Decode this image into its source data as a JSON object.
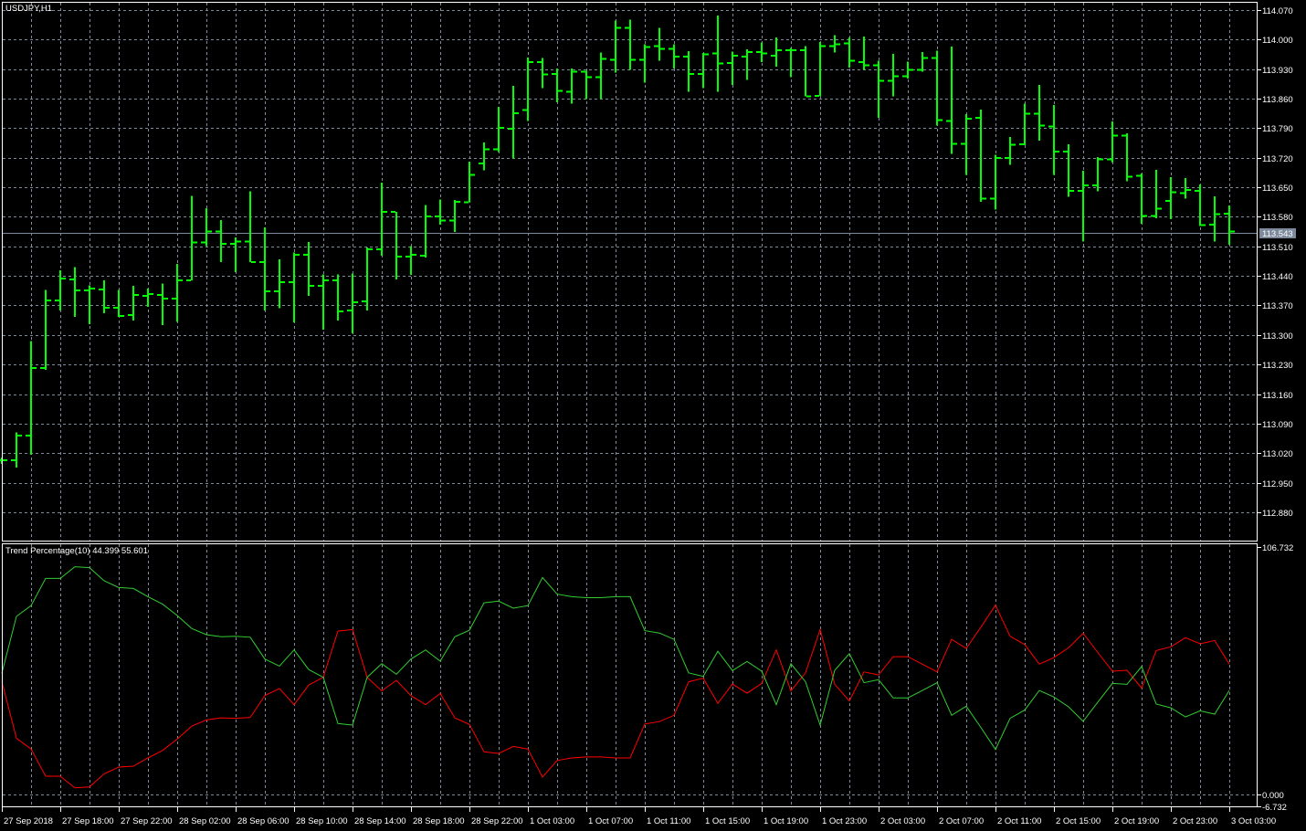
{
  "chart": {
    "symbol_title": "USDJPY,H1",
    "current_price": "113.543",
    "colors": {
      "background": "#000000",
      "bars": "#00ff00",
      "grid": "#7c8a9c",
      "frame": "#ffffff",
      "price_line": "#7c8a9c",
      "indicator_up": "#32cd32",
      "indicator_down": "#ff0000"
    },
    "price_axis_labels": [
      "114.070",
      "114.000",
      "113.930",
      "113.860",
      "113.790",
      "113.720",
      "113.650",
      "113.580",
      "113.510",
      "113.440",
      "113.370",
      "113.300",
      "113.230",
      "113.160",
      "113.090",
      "113.020",
      "112.950",
      "112.880"
    ],
    "time_axis_labels": [
      "27 Sep 2018",
      "27 Sep 18:00",
      "27 Sep 22:00",
      "28 Sep 02:00",
      "28 Sep 06:00",
      "28 Sep 10:00",
      "28 Sep 14:00",
      "28 Sep 18:00",
      "28 Sep 22:00",
      "1 Oct 03:00",
      "1 Oct 07:00",
      "1 Oct 11:00",
      "1 Oct 15:00",
      "1 Oct 19:00",
      "1 Oct 23:00",
      "2 Oct 03:00",
      "2 Oct 07:00",
      "2 Oct 11:00",
      "2 Oct 15:00",
      "2 Oct 19:00",
      "2 Oct 23:00",
      "3 Oct 03:00"
    ],
    "ohlc": [
      [
        113.003,
        113.01,
        112.995,
        113.003
      ],
      [
        113.003,
        113.069,
        112.986,
        113.062
      ],
      [
        113.062,
        113.286,
        113.016,
        113.222
      ],
      [
        113.222,
        113.407,
        113.217,
        113.382
      ],
      [
        113.382,
        113.453,
        113.358,
        113.434
      ],
      [
        113.432,
        113.461,
        113.343,
        113.406
      ],
      [
        113.406,
        113.418,
        113.326,
        113.41
      ],
      [
        113.408,
        113.429,
        113.352,
        113.365
      ],
      [
        113.365,
        113.407,
        113.343,
        113.345
      ],
      [
        113.347,
        113.416,
        113.334,
        113.395
      ],
      [
        113.393,
        113.41,
        113.367,
        113.397
      ],
      [
        113.395,
        113.422,
        113.324,
        113.386
      ],
      [
        113.386,
        113.468,
        113.331,
        113.43
      ],
      [
        113.43,
        113.63,
        113.43,
        113.519
      ],
      [
        113.519,
        113.6,
        113.511,
        113.545
      ],
      [
        113.545,
        113.572,
        113.473,
        113.516
      ],
      [
        113.516,
        113.531,
        113.449,
        113.521
      ],
      [
        113.521,
        113.641,
        113.473,
        113.473
      ],
      [
        113.473,
        113.555,
        113.358,
        113.404
      ],
      [
        113.404,
        113.479,
        113.363,
        113.425
      ],
      [
        113.425,
        113.496,
        113.33,
        113.49
      ],
      [
        113.49,
        113.52,
        113.393,
        113.417
      ],
      [
        113.417,
        113.444,
        113.313,
        113.43
      ],
      [
        113.43,
        113.444,
        113.334,
        113.356
      ],
      [
        113.358,
        113.446,
        113.304,
        113.378
      ],
      [
        113.38,
        113.507,
        113.358,
        113.503
      ],
      [
        113.503,
        113.661,
        113.488,
        113.592
      ],
      [
        113.592,
        113.592,
        113.432,
        113.486
      ],
      [
        113.486,
        113.511,
        113.443,
        113.49
      ],
      [
        113.488,
        113.608,
        113.484,
        113.581
      ],
      [
        113.581,
        113.621,
        113.562,
        113.571
      ],
      [
        113.571,
        113.62,
        113.544,
        113.616
      ],
      [
        113.614,
        113.711,
        113.614,
        113.679
      ],
      [
        113.707,
        113.756,
        113.69,
        113.74
      ],
      [
        113.74,
        113.841,
        113.733,
        113.791
      ],
      [
        113.789,
        113.89,
        113.718,
        113.826
      ],
      [
        113.833,
        113.958,
        113.807,
        113.947
      ],
      [
        113.947,
        113.956,
        113.885,
        113.917
      ],
      [
        113.919,
        113.932,
        113.851,
        113.878
      ],
      [
        113.876,
        113.931,
        113.848,
        113.924
      ],
      [
        113.924,
        113.926,
        113.859,
        113.911
      ],
      [
        113.911,
        113.969,
        113.859,
        113.954
      ],
      [
        113.952,
        114.045,
        113.922,
        114.028
      ],
      [
        114.028,
        114.047,
        113.928,
        113.952
      ],
      [
        113.952,
        113.989,
        113.898,
        113.982
      ],
      [
        113.984,
        114.028,
        113.95,
        113.978
      ],
      [
        113.978,
        113.989,
        113.932,
        113.96
      ],
      [
        113.96,
        113.973,
        113.876,
        113.919
      ],
      [
        113.919,
        113.968,
        113.885,
        113.965
      ],
      [
        113.967,
        114.057,
        113.876,
        113.943
      ],
      [
        113.945,
        113.972,
        113.893,
        113.962
      ],
      [
        113.96,
        113.977,
        113.904,
        113.971
      ],
      [
        113.971,
        113.993,
        113.947,
        113.967
      ],
      [
        113.962,
        114.005,
        113.936,
        113.975
      ],
      [
        113.975,
        113.98,
        113.911,
        113.975
      ],
      [
        113.975,
        113.984,
        113.866,
        113.866
      ],
      [
        113.867,
        113.994,
        113.867,
        113.984
      ],
      [
        113.984,
        114.011,
        113.969,
        113.989
      ],
      [
        113.991,
        114.005,
        113.934,
        113.95
      ],
      [
        113.947,
        114.007,
        113.928,
        113.939
      ],
      [
        113.939,
        113.95,
        113.815,
        113.902
      ],
      [
        113.902,
        113.966,
        113.865,
        113.913
      ],
      [
        113.913,
        113.948,
        113.908,
        113.928
      ],
      [
        113.928,
        113.97,
        113.924,
        113.956
      ],
      [
        113.956,
        113.974,
        113.796,
        113.809
      ],
      [
        113.807,
        113.983,
        113.729,
        113.753
      ],
      [
        113.753,
        113.823,
        113.679,
        113.813
      ],
      [
        113.815,
        113.834,
        113.616,
        113.623
      ],
      [
        113.623,
        113.727,
        113.597,
        113.72
      ],
      [
        113.72,
        113.769,
        113.703,
        113.751
      ],
      [
        113.752,
        113.848,
        113.75,
        113.824
      ],
      [
        113.824,
        113.893,
        113.761,
        113.796
      ],
      [
        113.794,
        113.845,
        113.679,
        113.735
      ],
      [
        113.735,
        113.752,
        113.627,
        113.642
      ],
      [
        113.642,
        113.689,
        113.521,
        113.655
      ],
      [
        113.655,
        113.722,
        113.64,
        113.716
      ],
      [
        113.716,
        113.806,
        113.709,
        113.772
      ],
      [
        113.772,
        113.778,
        113.664,
        113.675
      ],
      [
        113.677,
        113.683,
        113.564,
        113.582
      ],
      [
        113.582,
        113.691,
        113.577,
        113.599
      ],
      [
        113.618,
        113.674,
        113.575,
        113.638
      ],
      [
        113.636,
        113.672,
        113.623,
        113.644
      ],
      [
        113.642,
        113.657,
        113.558,
        113.56
      ],
      [
        113.562,
        113.629,
        113.521,
        113.586
      ],
      [
        113.588,
        113.607,
        113.514,
        113.545
      ]
    ]
  },
  "indicator": {
    "label": "Trend Percentage(10) 44.399 55.601",
    "axis_labels": {
      "top": "106.732",
      "zero": "0.000",
      "bottom": "-6.732"
    },
    "range": [
      -6.732,
      106.732
    ],
    "up_values": [
      51.7,
      76.0,
      80.6,
      92.2,
      92.2,
      97.2,
      96.8,
      91.2,
      88.3,
      87.9,
      84.4,
      81.2,
      76.4,
      70.8,
      68.2,
      67.3,
      67.5,
      67.1,
      57.8,
      54.8,
      61.7,
      53.3,
      50.0,
      30.3,
      29.6,
      50.0,
      55.8,
      51.3,
      57.8,
      61.7,
      56.9,
      67.3,
      70.1,
      81.8,
      82.5,
      79.5,
      80.6,
      92.6,
      85.5,
      84.4,
      84.0,
      84.0,
      84.4,
      84.4,
      69.9,
      68.9,
      66.2,
      51.9,
      50.4,
      61.1,
      52.9,
      56.8,
      52.6,
      38.3,
      55.8,
      48.1,
      29.6,
      53.0,
      60.1,
      47.7,
      49.0,
      41.2,
      41.2,
      44.4,
      47.7,
      33.8,
      37.7,
      28.6,
      19.2,
      32.5,
      36.0,
      44.4,
      41.6,
      37.4,
      31.2,
      39.4,
      47.4,
      47.0,
      54.6,
      38.6,
      37.0,
      33.1,
      35.7,
      34.3,
      44.399
    ],
    "note_down_is_100_minus_up": true
  }
}
